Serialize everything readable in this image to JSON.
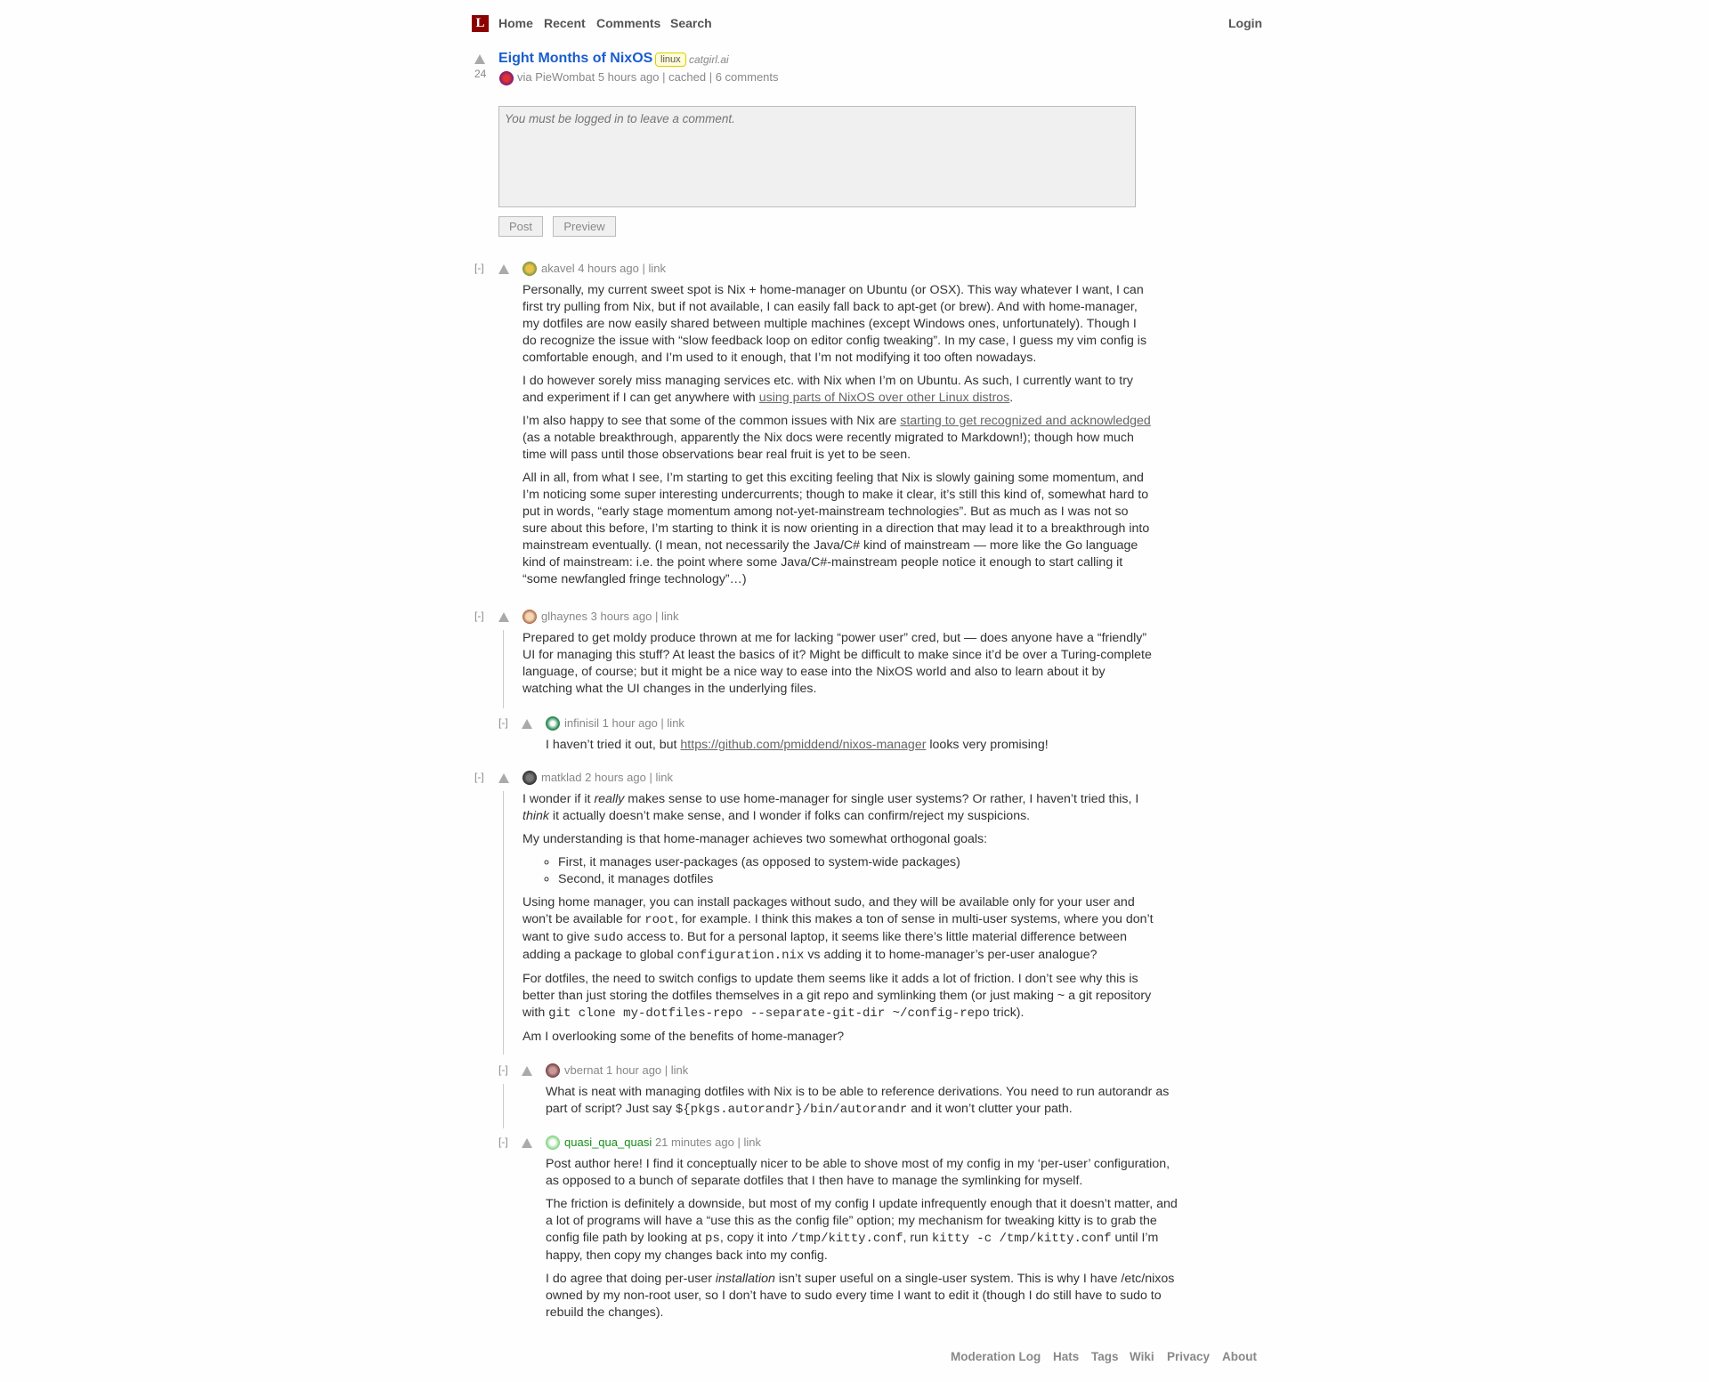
{
  "header": {
    "logo": "L",
    "nav": [
      "Home",
      "Recent",
      "Comments",
      "Search"
    ],
    "login": "Login"
  },
  "story": {
    "votes": "24",
    "title": "Eight Months of NixOS",
    "tag": "linux",
    "domain": "catgirl.ai",
    "byline_prefix": "via",
    "author": "PieWombat",
    "time": "5 hours ago",
    "sep": "|",
    "cached": "cached",
    "comments": "6 comments"
  },
  "comment_form": {
    "placeholder": "You must be logged in to leave a comment.",
    "post": "Post",
    "preview": "Preview"
  },
  "comments": [
    {
      "collapse": "[-]",
      "user": "akavel",
      "time": "4 hours ago",
      "link": "link",
      "p1": "Personally, my current sweet spot is Nix + home-manager on Ubuntu (or OSX). This way whatever I want, I can first try pulling from Nix, but if not available, I can easily fall back to apt-get (or brew). And with home-manager, my dotfiles are now easily shared between multiple machines (except Windows ones, unfortunately). Though I do recognize the issue with “slow feedback loop on editor config tweaking”. In my case, I guess my vim config is comfortable enough, and I’m used to it enough, that I’m not modifying it too often nowadays.",
      "p2a": "I do however sorely miss managing services etc. with Nix when I’m on Ubuntu. As such, I currently want to try and experiment if I can get anywhere with ",
      "p2link": "using parts of NixOS over other Linux distros",
      "p2b": ".",
      "p3a": "I’m also happy to see that some of the common issues with Nix are ",
      "p3link": "starting to get recognized and acknowledged",
      "p3b": " (as a notable breakthrough, apparently the Nix docs were recently migrated to Markdown!); though how much time will pass until those observations bear real fruit is yet to be seen.",
      "p4": "All in all, from what I see, I’m starting to get this exciting feeling that Nix is slowly gaining some momentum, and I’m noticing some super interesting undercurrents; though to make it clear, it’s still this kind of, somewhat hard to put in words, “early stage momentum among not-yet-mainstream technologies”. But as much as I was not so sure about this before, I’m starting to think it is now orienting in a direction that may lead it to a breakthrough into mainstream eventually. (I mean, not necessarily the Java/C# kind of mainstream — more like the Go language kind of mainstream: i.e. the point where some Java/C#-mainstream people notice it enough to start calling it “some newfangled fringe technology”…)"
    },
    {
      "collapse": "[-]",
      "user": "glhaynes",
      "time": "3 hours ago",
      "link": "link",
      "p1": "Prepared to get moldy produce thrown at me for lacking “power user” cred, but — does anyone have a “friendly” UI for managing this stuff? At least the basics of it? Might be difficult to make since it’d be over a Turing-complete language, of course; but it might be a nice way to ease into the NixOS world and also to learn about it by watching what the UI changes in the underlying files."
    },
    {
      "collapse": "[-]",
      "user": "infinisil",
      "time": "1 hour ago",
      "link": "link",
      "p1a": "I haven’t tried it out, but ",
      "p1link": "https://github.com/pmiddend/nixos-manager",
      "p1b": " looks very promising!"
    },
    {
      "collapse": "[-]",
      "user": "matklad",
      "time": "2 hours ago",
      "link": "link",
      "p1a": "I wonder if it ",
      "p1em": "really",
      "p1b": " makes sense to use home-manager for single user systems? Or rather, I haven’t tried this, I ",
      "p1em2": "think",
      "p1c": " it actually doesn’t make sense, and I wonder if folks can confirm/reject my suspicions.",
      "p2": "My understanding is that home-manager achieves two somewhat orthogonal goals:",
      "li1": "First, it manages user-packages (as opposed to system-wide packages)",
      "li2": "Second, it manages dotfiles",
      "p3a": "Using home manager, you can install packages without sudo, and they will be available only for your user and won’t be available for ",
      "p3c1": "root",
      "p3b": ", for example. I think this makes a ton of sense in multi-user systems, where you don’t want to give ",
      "p3c2": "sudo",
      "p3c": " access to. But for a personal laptop, it seems like there’s little material difference between adding a package to global ",
      "p3c3": "configuration.nix",
      "p3d": " vs adding it to home-manager’s per-user analogue?",
      "p4a": "For dotfiles, the need to switch configs to update them seems like it adds a lot of friction. I don’t see why this is better than just storing the dotfiles themselves in a git repo and symlinking them (or just making ~ a git repository with ",
      "p4c": "git clone my-dotfiles-repo --separate-git-dir ~/config-repo",
      "p4b": " trick).",
      "p5": "Am I overlooking some of the benefits of home-manager?"
    },
    {
      "collapse": "[-]",
      "user": "vbernat",
      "time": "1 hour ago",
      "link": "link",
      "p1a": "What is neat with managing dotfiles with Nix is to be able to reference derivations. You need to run autorandr as part of script? Just say ",
      "p1c": "${pkgs.autorandr}/bin/autorandr",
      "p1b": " and it won’t clutter your path."
    },
    {
      "collapse": "[-]",
      "user": "quasi_qua_quasi",
      "time": "21 minutes ago",
      "link": "link",
      "p1": "Post author here! I find it conceptually nicer to be able to shove most of my config in my ‘per-user’ configuration, as opposed to a bunch of separate dotfiles that I then have to manage the symlinking for myself.",
      "p2a": "The friction is definitely a downside, but most of my config I update infrequently enough that it doesn’t matter, and a lot of programs will have a “use this as the config file” option; my mechanism for tweaking kitty is to grab the config file path by looking at ",
      "p2c1": "ps",
      "p2b": ", copy it into ",
      "p2c2": "/tmp/kitty.conf",
      "p2c": ", run ",
      "p2c3": "kitty -c /tmp/kitty.conf",
      "p2d": " until I’m happy, then copy my changes back into my config.",
      "p3a": "I do agree that doing per-user ",
      "p3em": "installation",
      "p3b": " isn’t super useful on a single-user system. This is why I have /etc/nixos owned by my non-root user, so I don’t have to sudo every time I want to edit it (though I do still have to sudo to rebuild the changes)."
    }
  ],
  "footer": [
    "Moderation Log",
    "Hats",
    "Tags",
    "Wiki",
    "Privacy",
    "About"
  ],
  "colors": {
    "title": "#1a5dce",
    "logo": "#8b0000",
    "op": "#1a8c1a"
  }
}
